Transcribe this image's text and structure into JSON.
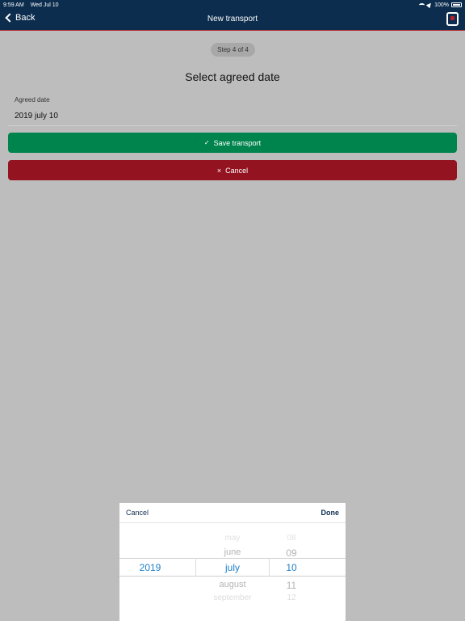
{
  "status": {
    "time": "9:59 AM",
    "date": "Wed Jul 10",
    "battery": "100%"
  },
  "nav": {
    "back_label": "Back",
    "title": "New transport"
  },
  "step_badge": "Step 4 of 4",
  "heading": "Select agreed date",
  "field": {
    "label": "Agreed date",
    "value": "2019 july 10"
  },
  "buttons": {
    "save": "Save transport",
    "cancel": "Cancel"
  },
  "picker": {
    "cancel": "Cancel",
    "done": "Done",
    "year": "2019",
    "months": [
      "may",
      "june",
      "july",
      "august",
      "september"
    ],
    "days": [
      "08",
      "09",
      "10",
      "11",
      "12"
    ]
  },
  "colors": {
    "navbar": "#0c2d4e",
    "save": "#00844d",
    "cancel": "#941321",
    "accent": "#1f7fc8"
  }
}
